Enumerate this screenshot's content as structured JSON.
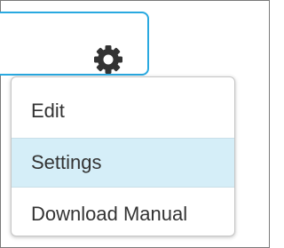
{
  "header": {
    "settings_icon": "gear-icon"
  },
  "menu": {
    "items": [
      {
        "label": "Edit",
        "state": "normal"
      },
      {
        "label": "Settings",
        "state": "hover"
      },
      {
        "label": "Download Manual",
        "state": "normal"
      }
    ]
  },
  "colors": {
    "card_border": "#29a9e0",
    "hover_background": "#d5eef8",
    "icon": "#333333",
    "text": "#333333"
  }
}
